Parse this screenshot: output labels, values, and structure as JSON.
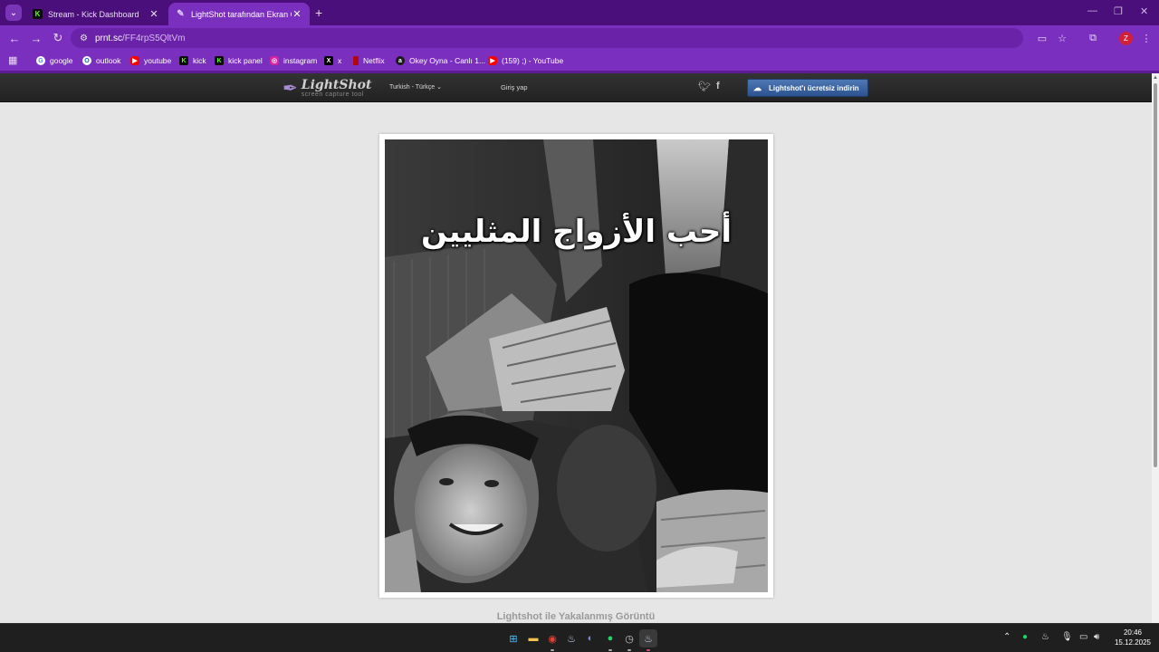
{
  "browser": {
    "tabs": [
      {
        "label": "Stream - Kick Dashboard",
        "icon": "kick-icon",
        "active": false
      },
      {
        "label": "LightShot tarafından Ekran Görü",
        "icon": "lightshot-icon",
        "active": true
      }
    ],
    "url": {
      "host": "prnt.sc",
      "path": "/FF4rpS5QltVm"
    },
    "profile_initial": "Z",
    "bookmarks": [
      {
        "label": "google",
        "icon": "google-icon"
      },
      {
        "label": "outlook",
        "icon": "outlook-icon"
      },
      {
        "label": "youtube",
        "icon": "youtube-icon"
      },
      {
        "label": "kick",
        "icon": "kick-icon"
      },
      {
        "label": "kick panel",
        "icon": "kick-icon"
      },
      {
        "label": "instagram",
        "icon": "instagram-icon"
      },
      {
        "label": "x",
        "icon": "x-icon"
      },
      {
        "label": "Netflix",
        "icon": "netflix-icon"
      },
      {
        "label": "Okey Oyna - Canlı 1...",
        "icon": "okey-icon"
      },
      {
        "label": "(159) ;) - YouTube",
        "icon": "youtube-icon"
      }
    ],
    "accent": "#7b2fbe"
  },
  "lightshot": {
    "logo": {
      "name": "LightShot",
      "tagline": "screen capture tool"
    },
    "language": "Turkish - Türkçe",
    "login": "Giriş yap",
    "download_button": "Lightshot'ı ücretsiz indirin",
    "screenshot": {
      "overlay_text": "أحب الأزواج المثليين"
    },
    "caption": "Lightshot ile Yakalanmış Görüntü"
  },
  "taskbar": {
    "apps": [
      "windows-start-icon",
      "file-explorer-icon",
      "chrome-icon",
      "steam-icon",
      "discord-icon",
      "spotify-icon",
      "clock-app-icon",
      "steam-active-icon"
    ],
    "clock": {
      "time": "20:46",
      "date": "15.12.2025"
    }
  }
}
